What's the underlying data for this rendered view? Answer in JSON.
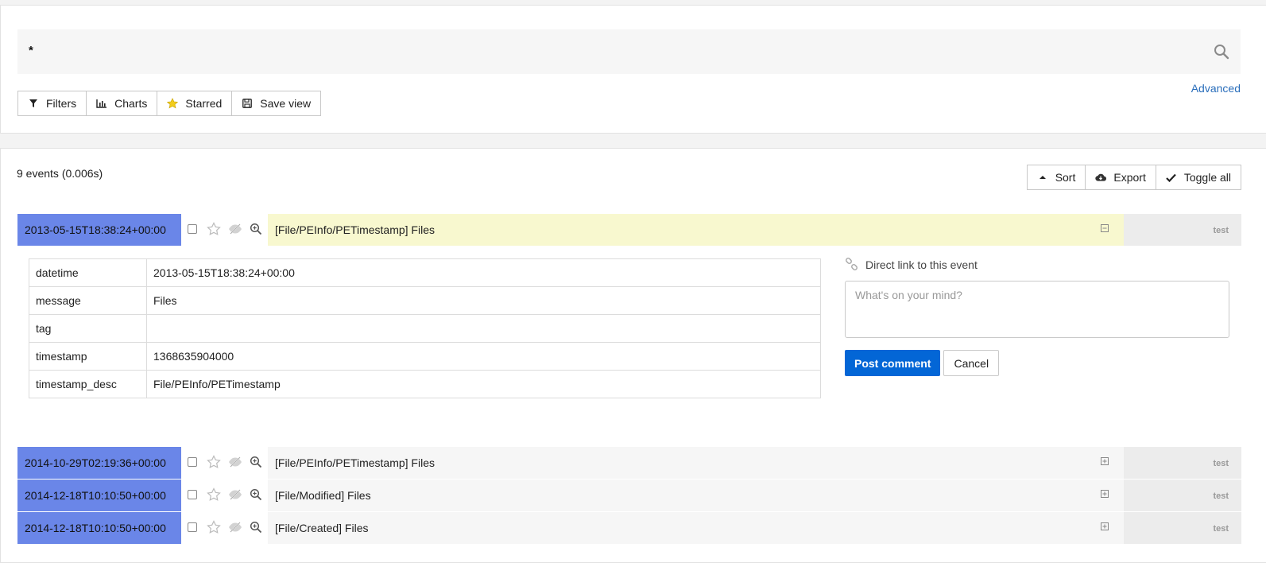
{
  "search": {
    "query": "*",
    "buttons": [
      {
        "label": "Filters",
        "icon": "filter-icon"
      },
      {
        "label": "Charts",
        "icon": "bar-chart-icon"
      },
      {
        "label": "Starred",
        "icon": "star-icon"
      },
      {
        "label": "Save view",
        "icon": "save-icon"
      }
    ],
    "advanced_label": "Advanced"
  },
  "results": {
    "count_text": "9 events (0.006s)",
    "tools": [
      {
        "label": "Sort",
        "icon": "caret-up-icon"
      },
      {
        "label": "Export",
        "icon": "cloud-download-icon"
      },
      {
        "label": "Toggle all",
        "icon": "check-icon"
      }
    ],
    "events": [
      {
        "datetime": "2013-05-15T18:38:24+00:00",
        "message": "[File/PEInfo/PETimestamp] Files",
        "source": "test",
        "expanded": true
      },
      {
        "datetime": "2014-10-29T02:19:36+00:00",
        "message": "[File/PEInfo/PETimestamp] Files",
        "source": "test",
        "expanded": false
      },
      {
        "datetime": "2014-12-18T10:10:50+00:00",
        "message": "[File/Modified] Files",
        "source": "test",
        "expanded": false
      },
      {
        "datetime": "2014-12-18T10:10:50+00:00",
        "message": "[File/Created] Files",
        "source": "test",
        "expanded": false
      }
    ],
    "detail": {
      "rows": [
        {
          "key": "datetime",
          "value": "2013-05-15T18:38:24+00:00"
        },
        {
          "key": "message",
          "value": "Files"
        },
        {
          "key": "tag",
          "value": ""
        },
        {
          "key": "timestamp",
          "value": "1368635904000"
        },
        {
          "key": "timestamp_desc",
          "value": "File/PEInfo/PETimestamp"
        }
      ],
      "direct_link_label": "Direct link to this event",
      "comment_placeholder": "What's on your mind?",
      "post_label": "Post comment",
      "cancel_label": "Cancel"
    }
  },
  "colors": {
    "date_cell": "#6a86e8",
    "expanded_message": "#f8f8cf",
    "primary_button": "#0366d6",
    "link": "#2a6ebb"
  }
}
